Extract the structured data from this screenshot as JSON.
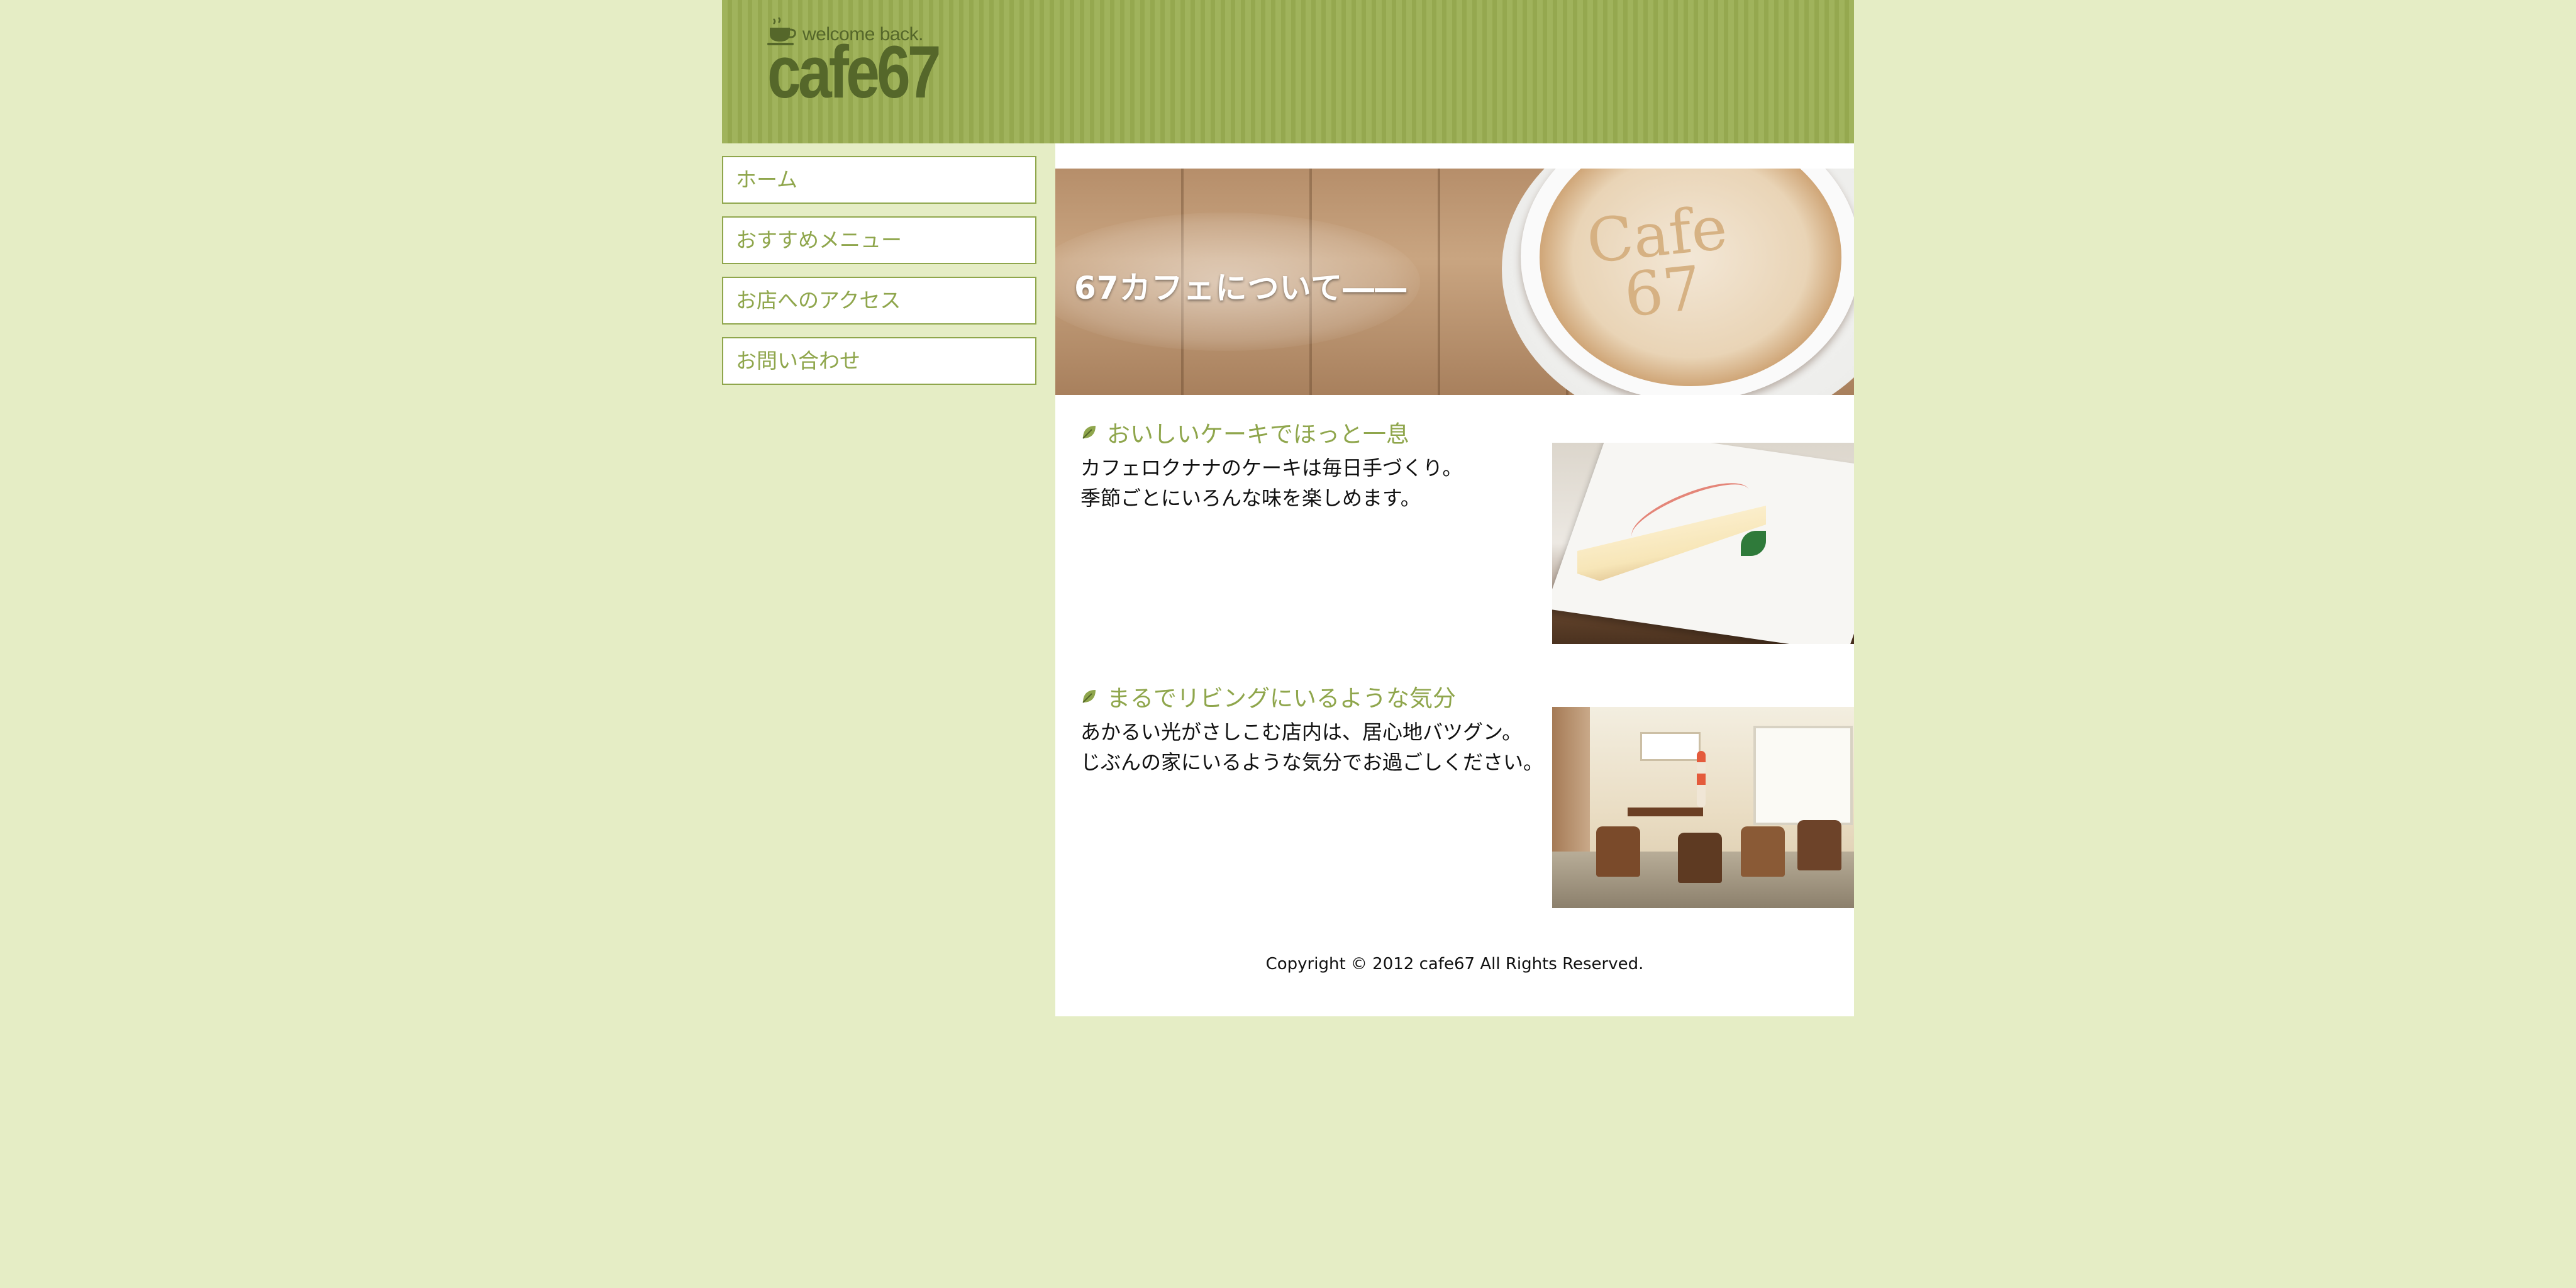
{
  "brand": {
    "tagline": "welcome back.",
    "name": "cafe67"
  },
  "nav": {
    "items": [
      {
        "label": "ホーム"
      },
      {
        "label": "おすすめメニュー"
      },
      {
        "label": "お店へのアクセス"
      },
      {
        "label": "お問い合わせ"
      }
    ]
  },
  "hero": {
    "caption": "67カフェについて――",
    "latte_art_text": "Cafe\n67"
  },
  "sections": [
    {
      "title": "おいしいケーキでほっと一息",
      "lines": [
        "カフェロクナナのケーキは毎日手づくり。",
        "季節ごとにいろんな味を楽しめます。"
      ]
    },
    {
      "title": "まるでリビングにいるような気分",
      "lines": [
        "あかるい光がさしこむ店内は、居心地バツグン。",
        "じぶんの家にいるような気分でお過ごしください。"
      ]
    }
  ],
  "footer": {
    "copyright": "Copyright © 2012 cafe67 All Rights Reserved."
  },
  "colors": {
    "page_background": "#e5edc5",
    "header_green": "#9cb057",
    "accent_green": "#8fa64c",
    "logo_dark_green": "#55672a",
    "content_background": "#ffffff"
  },
  "icons": {
    "logo": "coffee-cup-icon",
    "section_bullet": "leaf-icon"
  }
}
